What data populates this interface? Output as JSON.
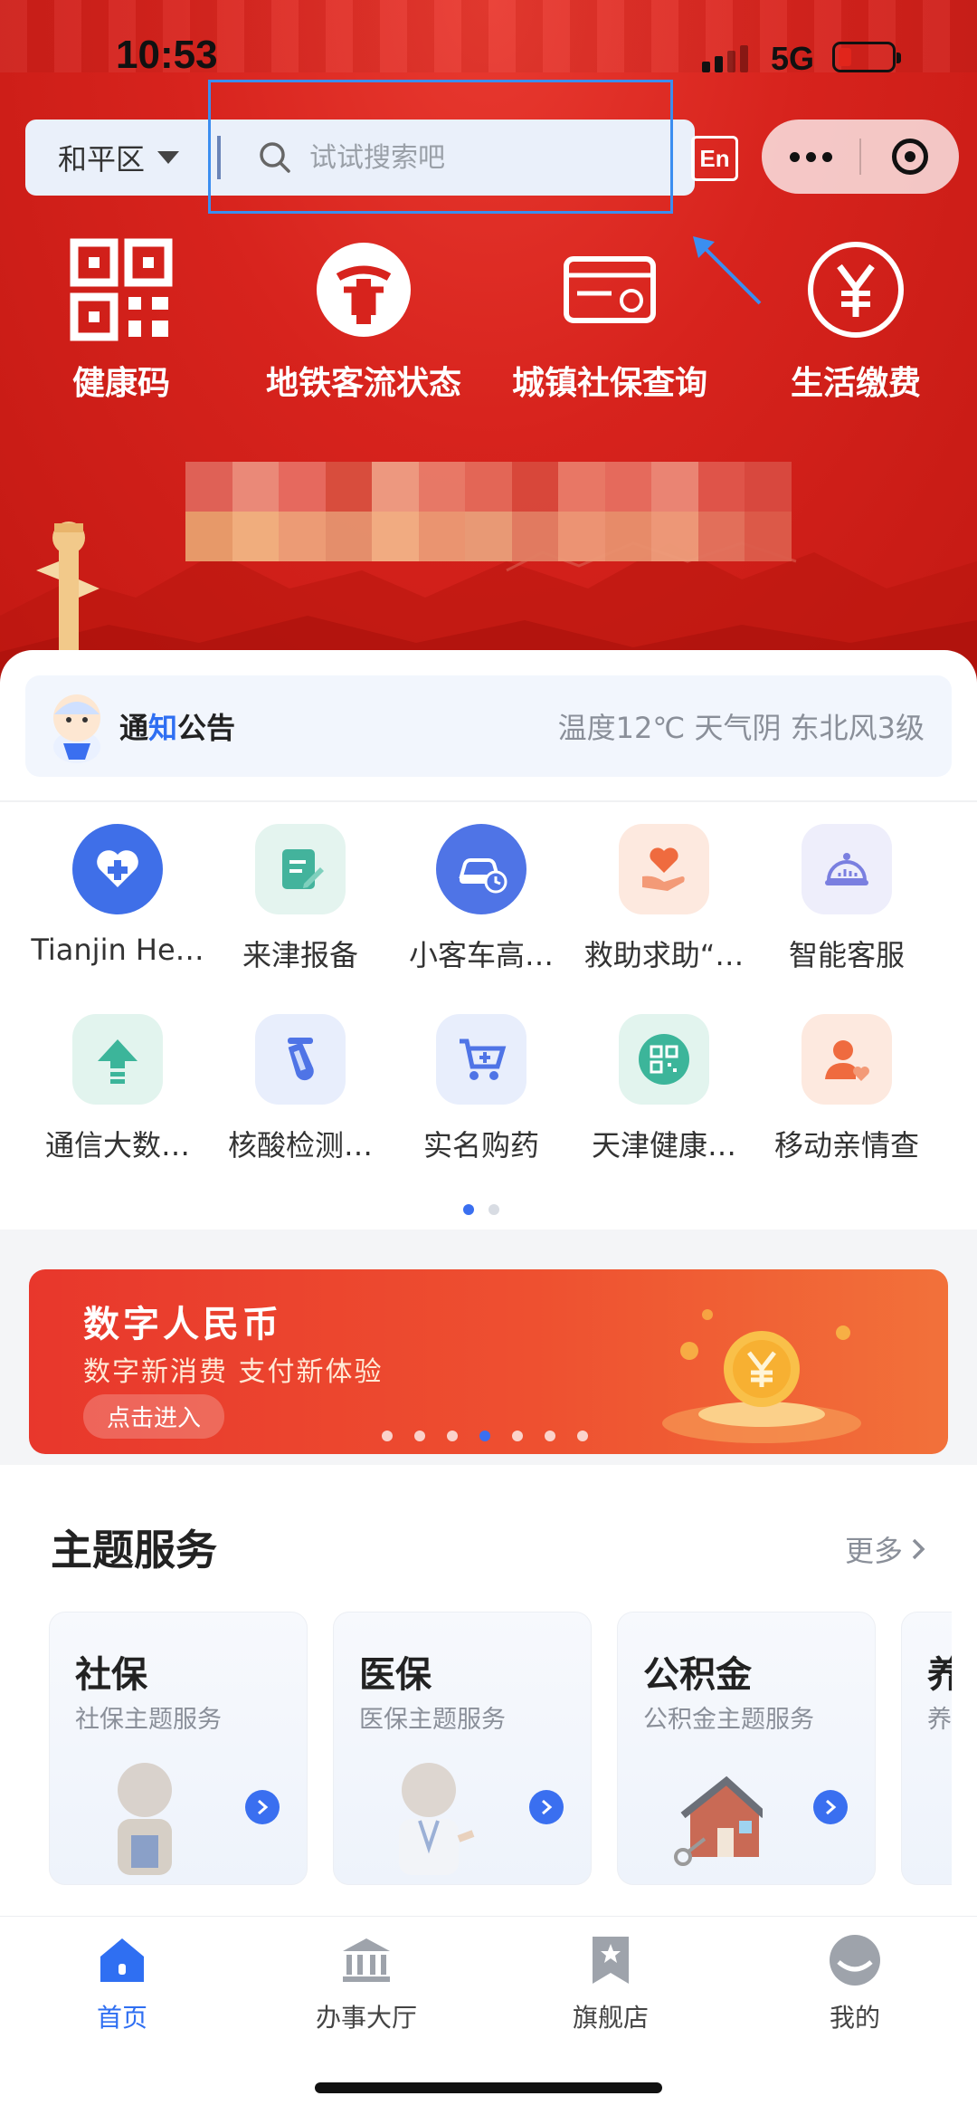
{
  "status": {
    "time": "10:53",
    "network": "5G"
  },
  "header": {
    "district": "和平区",
    "search_placeholder": "试试搜索吧",
    "lang_button": "En"
  },
  "quick_actions": [
    {
      "label": "健康码",
      "icon": "qr-code-icon"
    },
    {
      "label": "地铁客流状态",
      "icon": "metro-logo-icon"
    },
    {
      "label": "城镇社保查询",
      "icon": "social-security-card-icon"
    },
    {
      "label": "生活缴费",
      "icon": "yuan-coin-icon"
    }
  ],
  "notice": {
    "title_prefix": "通",
    "title_highlight": "知",
    "title_suffix": "公告",
    "weather": "温度12℃ 天气阴 东北风3级"
  },
  "services": [
    {
      "label": "Tianjin He…",
      "icon": "heart-plus-icon",
      "color": "#3f6fe8"
    },
    {
      "label": "来津报备",
      "icon": "edit-note-icon",
      "color": "#43b39c"
    },
    {
      "label": "小客车高…",
      "icon": "car-clock-icon",
      "color": "#4f74e6"
    },
    {
      "label": "救助求助“…",
      "icon": "heart-hand-icon",
      "color": "#ef6b3f"
    },
    {
      "label": "智能客服",
      "icon": "robot-service-icon",
      "color": "#7a7fe0"
    },
    {
      "label": "通信大数…",
      "icon": "upload-arrow-icon",
      "color": "#3cb59a"
    },
    {
      "label": "核酸检测…",
      "icon": "test-tube-icon",
      "color": "#4f74e6"
    },
    {
      "label": "实名购药",
      "icon": "cart-plus-icon",
      "color": "#4f74e6"
    },
    {
      "label": "天津健康…",
      "icon": "qr-badge-icon",
      "color": "#3cb59a"
    },
    {
      "label": "移动亲情查",
      "icon": "person-heart-icon",
      "color": "#ef6b3f"
    }
  ],
  "banner": {
    "title": "数字人民币",
    "subtitle": "数字新消费 支付新体验",
    "button": "点击进入"
  },
  "theme": {
    "heading": "主题服务",
    "more": "更多",
    "cards": [
      {
        "title": "社保",
        "subtitle": "社保主题服务"
      },
      {
        "title": "医保",
        "subtitle": "医保主题服务"
      },
      {
        "title": "公积金",
        "subtitle": "公积金主题服务"
      },
      {
        "title": "养",
        "subtitle": "养"
      }
    ]
  },
  "tabs": [
    {
      "label": "首页",
      "active": true
    },
    {
      "label": "办事大厅",
      "active": false
    },
    {
      "label": "旗舰店",
      "active": false
    },
    {
      "label": "我的",
      "active": false
    }
  ],
  "colors": {
    "primary_red": "#d7231d",
    "accent_blue": "#2f6ff2"
  }
}
